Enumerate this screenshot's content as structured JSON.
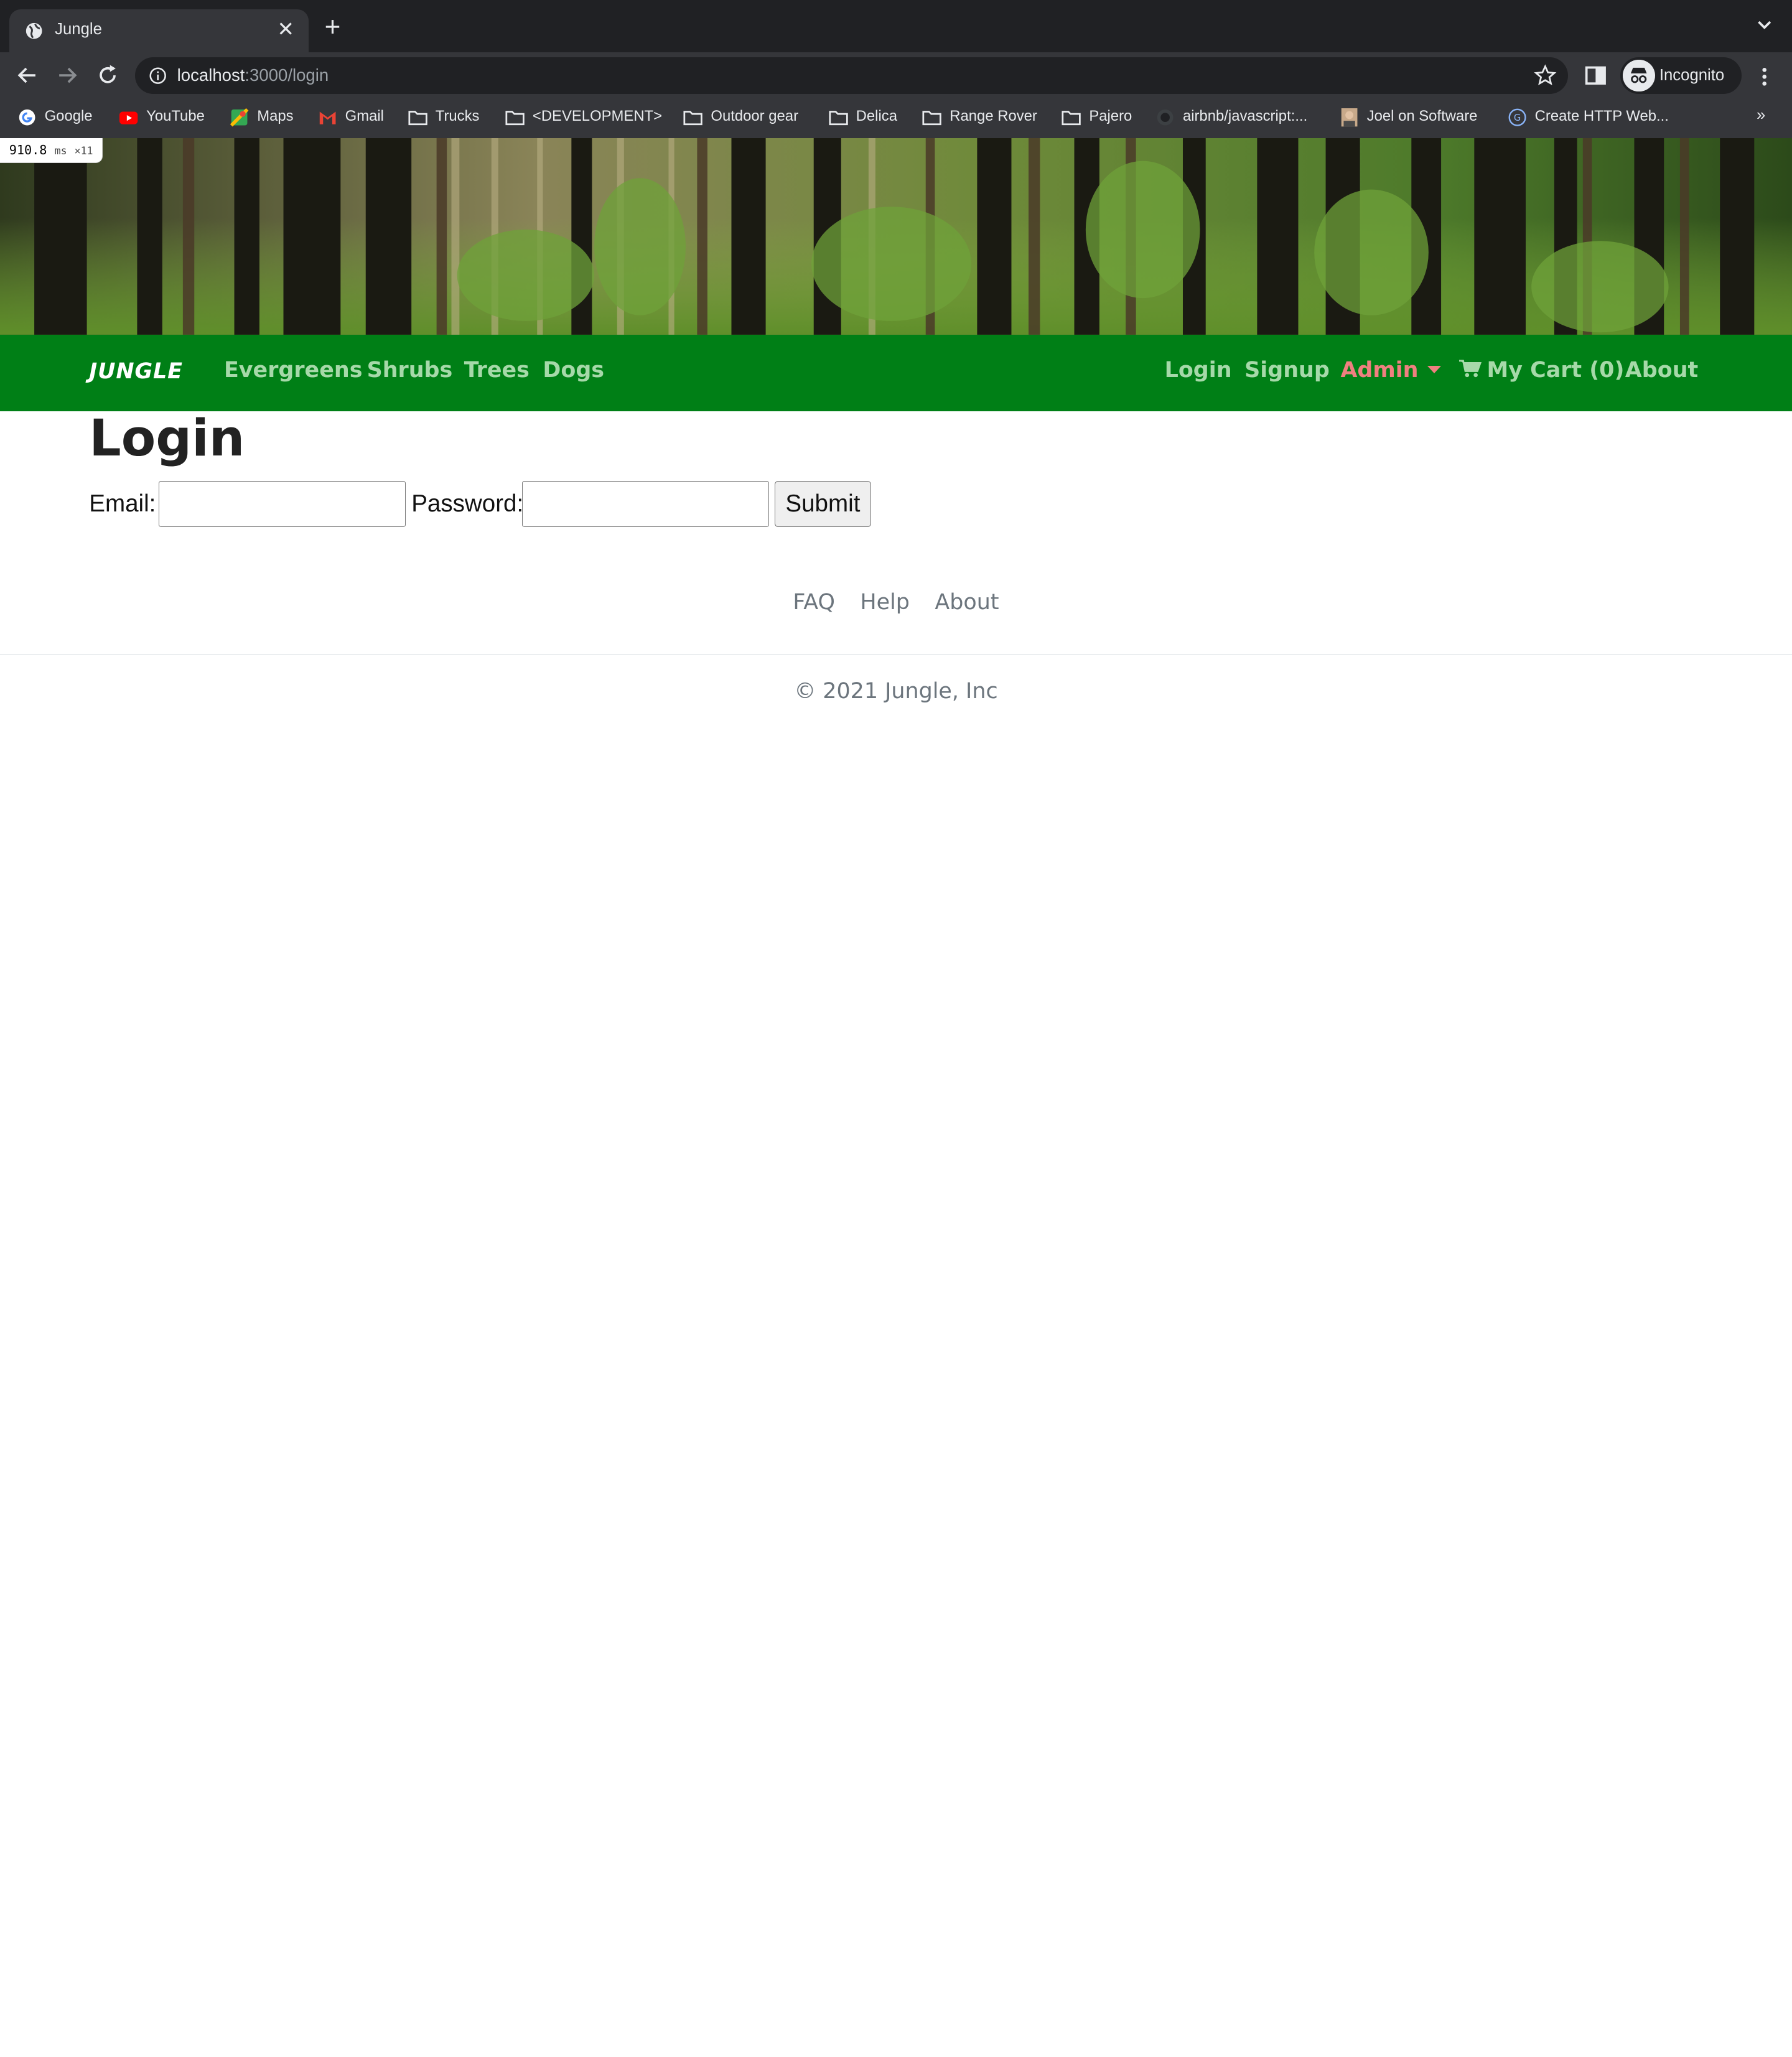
{
  "browser": {
    "tab_title": "Jungle",
    "url_host": "localhost",
    "url_rest": ":3000/login",
    "profile_label": "Incognito",
    "bookmarks": [
      "Google",
      "YouTube",
      "Maps",
      "Gmail",
      "Trucks",
      "<DEVELOPMENT>",
      "Outdoor gear",
      "Delica",
      "Range Rover",
      "Pajero",
      "airbnb/javascript:...",
      "Joel on Software",
      "Create HTTP Web..."
    ],
    "bookmarks_overflow": "»"
  },
  "perf_overlay": {
    "value": "910.8",
    "unit": "ms",
    "count": "×11"
  },
  "navbar": {
    "brand": "JUNGLE",
    "left_links": [
      "Evergreens",
      "Shrubs",
      "Trees",
      "Dogs"
    ],
    "login": "Login",
    "signup": "Signup",
    "admin": "Admin",
    "cart": "My Cart (0)",
    "about": "About",
    "colors": {
      "bar": "#007f16",
      "link": "#a6d9a9",
      "admin": "#f08080"
    }
  },
  "login_page": {
    "title": "Login",
    "email_label": "Email:",
    "password_label": "Password:",
    "email_value": "",
    "password_value": "",
    "submit_label": "Submit"
  },
  "footer": {
    "links": [
      "FAQ",
      "Help",
      "About"
    ],
    "copyright": "© 2021 Jungle, Inc"
  }
}
